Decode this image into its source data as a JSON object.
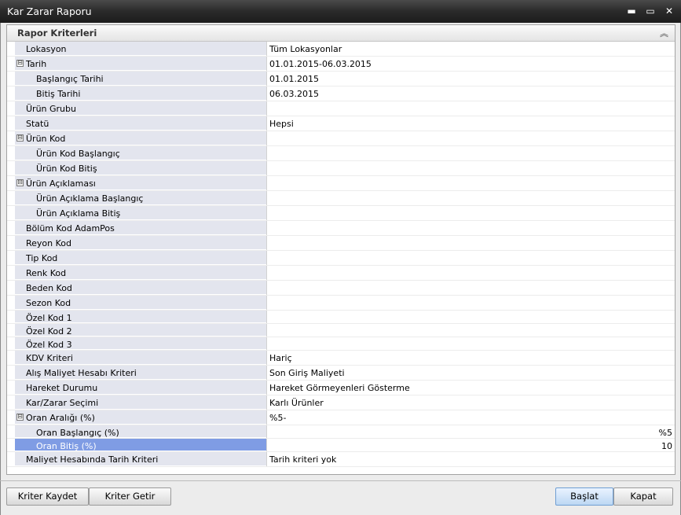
{
  "window": {
    "title": "Kar Zarar Raporu"
  },
  "panel": {
    "title": "Rapor Kriterleri"
  },
  "rows": [
    {
      "label": "Lokasyon",
      "value": "Tüm Lokasyonlar",
      "level": 0
    },
    {
      "label": "Tarih",
      "value": "01.01.2015-06.03.2015",
      "level": 0,
      "expander": "⊟"
    },
    {
      "label": "Başlangıç Tarihi",
      "value": "01.01.2015",
      "level": 1
    },
    {
      "label": "Bitiş Tarihi",
      "value": "06.03.2015",
      "level": 1
    },
    {
      "label": "Ürün Grubu",
      "value": "",
      "level": 0
    },
    {
      "label": "Statü",
      "value": "Hepsi",
      "level": 0
    },
    {
      "label": "Ürün Kod",
      "value": "",
      "level": 0,
      "expander": "⊟"
    },
    {
      "label": "Ürün Kod Başlangıç",
      "value": "",
      "level": 1
    },
    {
      "label": "Ürün Kod Bitiş",
      "value": "",
      "level": 1
    },
    {
      "label": "Ürün Açıklaması",
      "value": "",
      "level": 0,
      "expander": "⊟"
    },
    {
      "label": "Ürün Açıklama Başlangıç",
      "value": "",
      "level": 1
    },
    {
      "label": "Ürün Açıklama Bitiş",
      "value": "",
      "level": 1
    },
    {
      "label": "Bölüm Kod AdamPos",
      "value": "",
      "level": 0
    },
    {
      "label": "Reyon Kod",
      "value": "",
      "level": 0
    },
    {
      "label": "Tip Kod",
      "value": "",
      "level": 0
    },
    {
      "label": "Renk Kod",
      "value": "",
      "level": 0
    },
    {
      "label": "Beden Kod",
      "value": "",
      "level": 0
    },
    {
      "label": "Sezon Kod",
      "value": "",
      "level": 0
    },
    {
      "label": "Özel Kod 1",
      "value": "",
      "level": 0
    },
    {
      "label": "Özel Kod 2",
      "value": "",
      "level": 0
    },
    {
      "label": "Özel Kod 3",
      "value": "",
      "level": 0
    },
    {
      "label": "KDV Kriteri",
      "value": "Hariç",
      "level": 0
    },
    {
      "label": "Alış Maliyet Hesabı Kriteri",
      "value": "Son Giriş Maliyeti",
      "level": 0
    },
    {
      "label": "Hareket Durumu",
      "value": "Hareket Görmeyenleri Gösterme",
      "level": 0
    },
    {
      "label": "Kar/Zarar Seçimi",
      "value": "Karlı Ürünler",
      "level": 0
    },
    {
      "label": "Oran Aralığı (%)",
      "value": "%5-",
      "level": 0,
      "expander": "⊟"
    },
    {
      "label": "Oran Başlangıç (%)",
      "value": "%5",
      "level": 1,
      "align": "right"
    },
    {
      "label": "Oran Bitiş (%)",
      "value": "10",
      "level": 1,
      "align": "right",
      "selected": true
    },
    {
      "label": "Maliyet Hesabında Tarih Kriteri",
      "value": "Tarih kriteri yok",
      "level": 0
    }
  ],
  "buttons": {
    "save": "Kriter Kaydet",
    "load": "Kriter Getir",
    "start": "Başlat",
    "close": "Kapat"
  },
  "icons": {
    "minimize": "▬",
    "maximize": "▭",
    "close": "✕",
    "collapse": "︽"
  }
}
